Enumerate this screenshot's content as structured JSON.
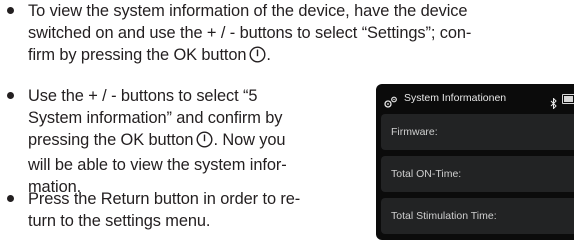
{
  "instructions": [
    {
      "lines": [
        "To view the system information of the device, have the device",
        "switched on and use the + / - buttons to select “Settings”; con-",
        "firm by pressing the OK button"
      ],
      "end_icon": "power-icon",
      "end_text": "."
    },
    {
      "lines": [
        "Use the + / - buttons to select “5",
        "System information” and confirm by",
        "pressing the OK button",
        "will be able to view the system infor-",
        "mation."
      ],
      "mid_icon_line": 2,
      "mid_icon": "power-icon",
      "mid_after": ". Now you"
    },
    {
      "lines": [
        "Press the Return button in order to re-",
        "turn to the settings menu."
      ]
    }
  ],
  "device_screen": {
    "title": "System Informationen",
    "header_icon": "settings-gear-icon",
    "status_icons": [
      "bluetooth-icon",
      "battery-icon"
    ],
    "rows": [
      "Firmware:",
      "Total ON-Time:",
      "Total Stimulation Time:"
    ]
  }
}
